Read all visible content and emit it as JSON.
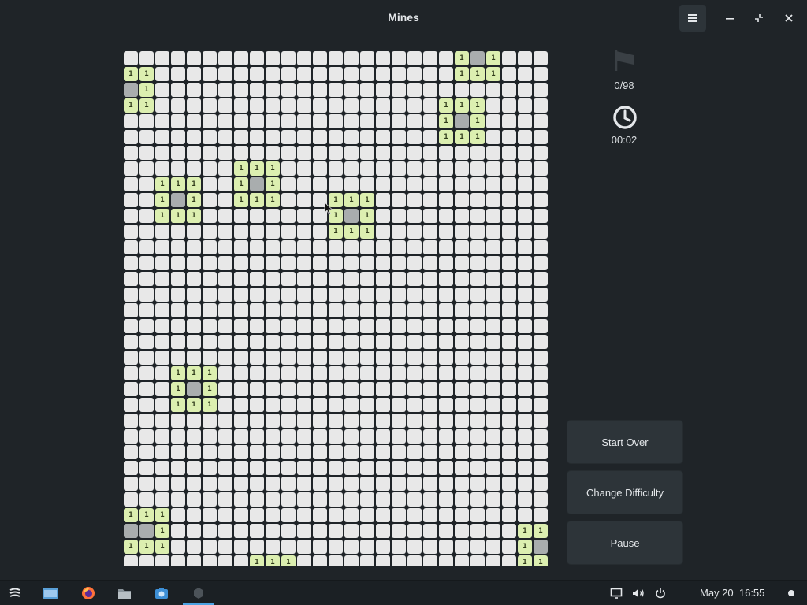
{
  "window": {
    "title": "Mines"
  },
  "status": {
    "flags": "0/98",
    "time": "00:02"
  },
  "buttons": {
    "start_over": "Start Over",
    "change_difficulty": "Change Difficulty",
    "pause": "Pause"
  },
  "taskbar": {
    "date_time": "May 20  16:55"
  },
  "board": {
    "cols": 27,
    "rows": 33,
    "revealed": [
      {
        "r": 0,
        "c": 21,
        "v": "1"
      },
      {
        "r": 0,
        "c": 22,
        "v": ""
      },
      {
        "r": 0,
        "c": 23,
        "v": "1"
      },
      {
        "r": 1,
        "c": 0,
        "v": "1"
      },
      {
        "r": 1,
        "c": 1,
        "v": "1"
      },
      {
        "r": 1,
        "c": 21,
        "v": "1"
      },
      {
        "r": 1,
        "c": 22,
        "v": "1"
      },
      {
        "r": 1,
        "c": 23,
        "v": "1"
      },
      {
        "r": 2,
        "c": 0,
        "v": ""
      },
      {
        "r": 2,
        "c": 1,
        "v": "1"
      },
      {
        "r": 3,
        "c": 0,
        "v": "1"
      },
      {
        "r": 3,
        "c": 1,
        "v": "1"
      },
      {
        "r": 3,
        "c": 20,
        "v": "1"
      },
      {
        "r": 3,
        "c": 21,
        "v": "1"
      },
      {
        "r": 3,
        "c": 22,
        "v": "1"
      },
      {
        "r": 4,
        "c": 20,
        "v": "1"
      },
      {
        "r": 4,
        "c": 21,
        "v": ""
      },
      {
        "r": 4,
        "c": 22,
        "v": "1"
      },
      {
        "r": 5,
        "c": 20,
        "v": "1"
      },
      {
        "r": 5,
        "c": 21,
        "v": "1"
      },
      {
        "r": 5,
        "c": 22,
        "v": "1"
      },
      {
        "r": 7,
        "c": 7,
        "v": "1"
      },
      {
        "r": 7,
        "c": 8,
        "v": "1"
      },
      {
        "r": 7,
        "c": 9,
        "v": "1"
      },
      {
        "r": 8,
        "c": 2,
        "v": "1"
      },
      {
        "r": 8,
        "c": 3,
        "v": "1"
      },
      {
        "r": 8,
        "c": 4,
        "v": "1"
      },
      {
        "r": 8,
        "c": 7,
        "v": "1"
      },
      {
        "r": 8,
        "c": 8,
        "v": ""
      },
      {
        "r": 8,
        "c": 9,
        "v": "1"
      },
      {
        "r": 9,
        "c": 2,
        "v": "1"
      },
      {
        "r": 9,
        "c": 3,
        "v": ""
      },
      {
        "r": 9,
        "c": 4,
        "v": "1"
      },
      {
        "r": 9,
        "c": 7,
        "v": "1"
      },
      {
        "r": 9,
        "c": 8,
        "v": "1"
      },
      {
        "r": 9,
        "c": 9,
        "v": "1"
      },
      {
        "r": 9,
        "c": 13,
        "v": "1"
      },
      {
        "r": 9,
        "c": 14,
        "v": "1"
      },
      {
        "r": 9,
        "c": 15,
        "v": "1"
      },
      {
        "r": 10,
        "c": 2,
        "v": "1"
      },
      {
        "r": 10,
        "c": 3,
        "v": "1"
      },
      {
        "r": 10,
        "c": 4,
        "v": "1"
      },
      {
        "r": 10,
        "c": 13,
        "v": "1"
      },
      {
        "r": 10,
        "c": 14,
        "v": ""
      },
      {
        "r": 10,
        "c": 15,
        "v": "1"
      },
      {
        "r": 11,
        "c": 13,
        "v": "1"
      },
      {
        "r": 11,
        "c": 14,
        "v": "1"
      },
      {
        "r": 11,
        "c": 15,
        "v": "1"
      },
      {
        "r": 20,
        "c": 3,
        "v": "1"
      },
      {
        "r": 20,
        "c": 4,
        "v": "1"
      },
      {
        "r": 20,
        "c": 5,
        "v": "1"
      },
      {
        "r": 21,
        "c": 3,
        "v": "1"
      },
      {
        "r": 21,
        "c": 4,
        "v": ""
      },
      {
        "r": 21,
        "c": 5,
        "v": "1"
      },
      {
        "r": 22,
        "c": 3,
        "v": "1"
      },
      {
        "r": 22,
        "c": 4,
        "v": "1"
      },
      {
        "r": 22,
        "c": 5,
        "v": "1"
      },
      {
        "r": 29,
        "c": 0,
        "v": "1"
      },
      {
        "r": 29,
        "c": 1,
        "v": "1"
      },
      {
        "r": 29,
        "c": 2,
        "v": "1"
      },
      {
        "r": 30,
        "c": 0,
        "v": ""
      },
      {
        "r": 30,
        "c": 1,
        "v": ""
      },
      {
        "r": 30,
        "c": 2,
        "v": "1"
      },
      {
        "r": 30,
        "c": 25,
        "v": "1"
      },
      {
        "r": 30,
        "c": 26,
        "v": "1"
      },
      {
        "r": 31,
        "c": 0,
        "v": "1"
      },
      {
        "r": 31,
        "c": 1,
        "v": "1"
      },
      {
        "r": 31,
        "c": 2,
        "v": "1"
      },
      {
        "r": 31,
        "c": 25,
        "v": "1"
      },
      {
        "r": 31,
        "c": 26,
        "v": ""
      },
      {
        "r": 32,
        "c": 8,
        "v": "1"
      },
      {
        "r": 32,
        "c": 9,
        "v": "1"
      },
      {
        "r": 32,
        "c": 10,
        "v": "1"
      },
      {
        "r": 32,
        "c": 25,
        "v": "1"
      },
      {
        "r": 32,
        "c": 26,
        "v": "1"
      }
    ]
  },
  "colors": {
    "background": "#1f2428",
    "cell_hidden": "#e8e8e8",
    "cell_number": "#dcefb0",
    "cell_empty": "#a9adae",
    "button_bg": "#2d3439",
    "accent": "#4ba3e3"
  },
  "icons": [
    "menu-icon",
    "minimize-icon",
    "restore-icon",
    "close-icon",
    "flag-icon",
    "clock-icon",
    "app-menu-icon",
    "files-window-icon",
    "firefox-icon",
    "folder-icon",
    "screenshot-icon",
    "mines-icon",
    "display-icon",
    "volume-icon",
    "power-icon"
  ]
}
